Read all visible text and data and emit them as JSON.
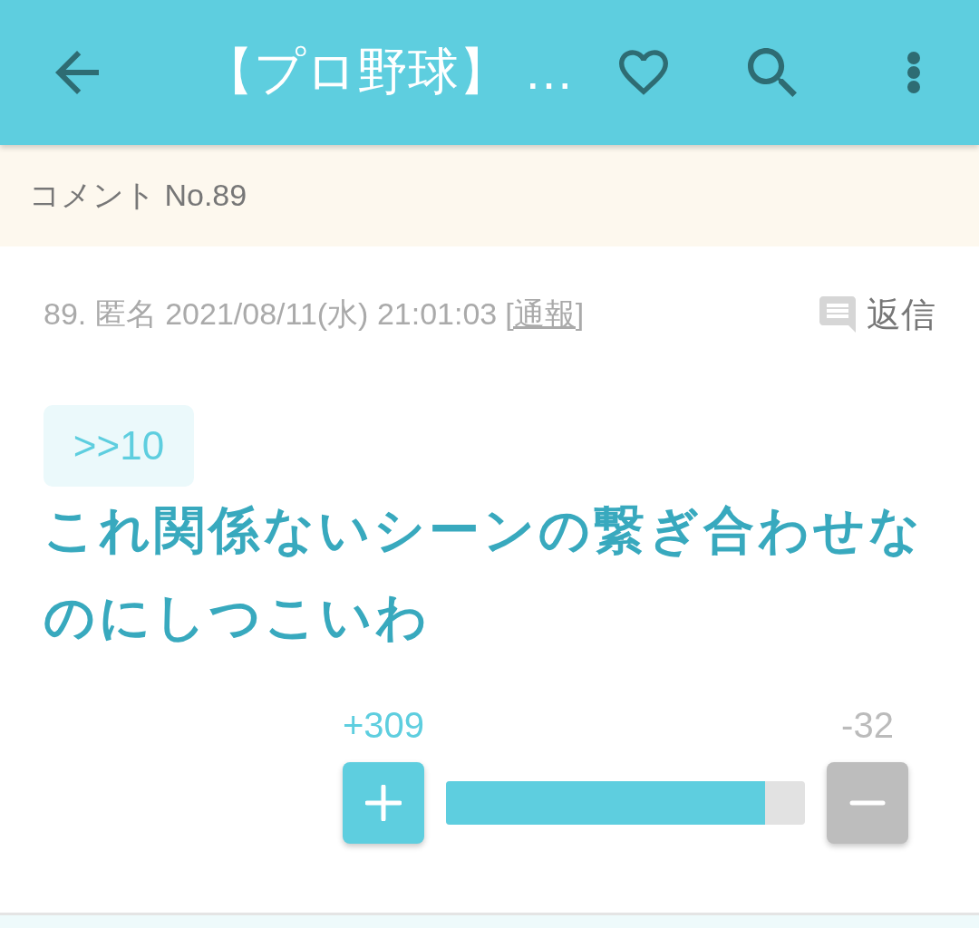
{
  "app_bar": {
    "title": "【プロ野球】 …"
  },
  "page_header": {
    "title": "コメント No.89"
  },
  "comment": {
    "meta": "89. 匿名 2021/08/11(水) 21:01:03",
    "report_link": "[通報]",
    "reply_label": "返信",
    "anchor": ">>10",
    "body": "これ関係ないシーンの繋ぎ合わせなのにしつこいわ",
    "votes": {
      "plus": "+309",
      "minus": "-32",
      "level": 0.89
    }
  }
}
